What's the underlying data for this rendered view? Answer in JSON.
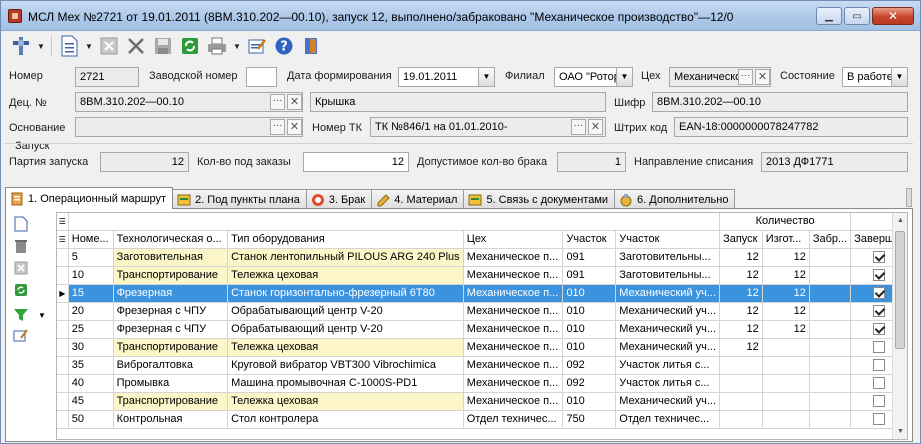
{
  "window": {
    "title": "МСЛ Мех №2721 от 19.01.2011 (8ВМ.310.202—00.10), запуск 12, выполнено/забраковано \"Механическое производство\"—12/0"
  },
  "form": {
    "nomer_label": "Номер",
    "nomer_value": "2721",
    "zavod_label": "Заводской номер",
    "zavod_value": "",
    "data_label": "Дата формирования",
    "data_value": "19.01.2011",
    "filial_label": "Филиал",
    "filial_value": "ОАО \"Ротор",
    "ceh_label": "Цех",
    "ceh_value": "Механическо",
    "sost_label": "Состояние",
    "sost_value": "В работе",
    "dec_label": "Дец. №",
    "dec_value": "8ВМ.310.202—00.10",
    "name_value": "Крышка",
    "shifr_label": "Шифр",
    "shifr_value": "8ВМ.310.202—00.10",
    "osn_label": "Основание",
    "osn_value": "",
    "tk_label": "Номер ТК",
    "tk_value": "ТК №846/1 на  01.01.2010-",
    "barcode_label": "Штрих код",
    "barcode_value": "EAN-18:0000000078247782",
    "zapusk_group": "Запуск",
    "partiya_label": "Партия запуска",
    "partiya_value": "12",
    "kol_zakaz_label": "Кол-во под заказы",
    "kol_zakaz_value": "12",
    "brak_label": "Допустимое кол-во брака",
    "brak_value": "1",
    "napr_label": "Направление списания",
    "napr_value": "2013  ДФ1771"
  },
  "tabs": [
    {
      "label": "1. Операционный маршрут"
    },
    {
      "label": "2. Под пункты плана"
    },
    {
      "label": "3. Брак"
    },
    {
      "label": "4. Материал"
    },
    {
      "label": "5. Связь с документами"
    },
    {
      "label": "6. Дополнительно"
    }
  ],
  "grid": {
    "group_header": "Количество",
    "columns": [
      "Номе...",
      "Технологическая о...",
      "Тип оборудования",
      "Цех",
      "Участок",
      "Участок",
      "Запуск",
      "Изгот...",
      "Забр...",
      "Заверш..."
    ],
    "rows": [
      {
        "no": "5",
        "op": "Заготовительная",
        "eq": "Станок лентопильный PILOUS ARG 240 Plus",
        "ceh": "Механическое п...",
        "uch1": "091",
        "uch2": "Заготовительны...",
        "zapusk": "12",
        "izg": "12",
        "zabr": "",
        "done": true,
        "hl": true,
        "sel": false
      },
      {
        "no": "10",
        "op": "Транспортирование",
        "eq": "Тележка цеховая",
        "ceh": "Механическое п...",
        "uch1": "091",
        "uch2": "Заготовительны...",
        "zapusk": "12",
        "izg": "12",
        "zabr": "",
        "done": true,
        "hl": true,
        "sel": false
      },
      {
        "no": "15",
        "op": "Фрезерная",
        "eq": "Станок горизонтально-фрезерный 6Т80",
        "ceh": "Механическое п...",
        "uch1": "010",
        "uch2": "Механический уч...",
        "zapusk": "12",
        "izg": "12",
        "zabr": "",
        "done": true,
        "hl": false,
        "sel": true
      },
      {
        "no": "20",
        "op": "Фрезерная с ЧПУ",
        "eq": "Обрабатывающий центр V-20",
        "ceh": "Механическое п...",
        "uch1": "010",
        "uch2": "Механический уч...",
        "zapusk": "12",
        "izg": "12",
        "zabr": "",
        "done": true,
        "hl": false,
        "sel": false
      },
      {
        "no": "25",
        "op": "Фрезерная с ЧПУ",
        "eq": "Обрабатывающий центр V-20",
        "ceh": "Механическое п...",
        "uch1": "010",
        "uch2": "Механический уч...",
        "zapusk": "12",
        "izg": "12",
        "zabr": "",
        "done": true,
        "hl": false,
        "sel": false
      },
      {
        "no": "30",
        "op": "Транспортирование",
        "eq": "Тележка цеховая",
        "ceh": "Механическое п...",
        "uch1": "010",
        "uch2": "Механический уч...",
        "zapusk": "12",
        "izg": "",
        "zabr": "",
        "done": false,
        "hl": true,
        "sel": false
      },
      {
        "no": "35",
        "op": "Виброгалтовка",
        "eq": "Круговой вибратор VBT300 Vibrochimica",
        "ceh": "Механическое п...",
        "uch1": "092",
        "uch2": "Участок литья с...",
        "zapusk": "",
        "izg": "",
        "zabr": "",
        "done": false,
        "hl": false,
        "sel": false
      },
      {
        "no": "40",
        "op": "Промывка",
        "eq": "Машина промывочная С-1000S-PD1",
        "ceh": "Механическое п...",
        "uch1": "092",
        "uch2": "Участок литья с...",
        "zapusk": "",
        "izg": "",
        "zabr": "",
        "done": false,
        "hl": false,
        "sel": false
      },
      {
        "no": "45",
        "op": "Транспортирование",
        "eq": "Тележка цеховая",
        "ceh": "Механическое п...",
        "uch1": "010",
        "uch2": "Механический уч...",
        "zapusk": "",
        "izg": "",
        "zabr": "",
        "done": false,
        "hl": true,
        "sel": false
      },
      {
        "no": "50",
        "op": "Контрольная",
        "eq": "Стол контролера",
        "ceh": "Отдел техничес...",
        "uch1": "750",
        "uch2": "Отдел техничес...",
        "zapusk": "",
        "izg": "",
        "zabr": "",
        "done": false,
        "hl": false,
        "sel": false
      }
    ]
  },
  "colors": {
    "selection": "#3b92dd",
    "highlight": "#fdf6c8"
  }
}
